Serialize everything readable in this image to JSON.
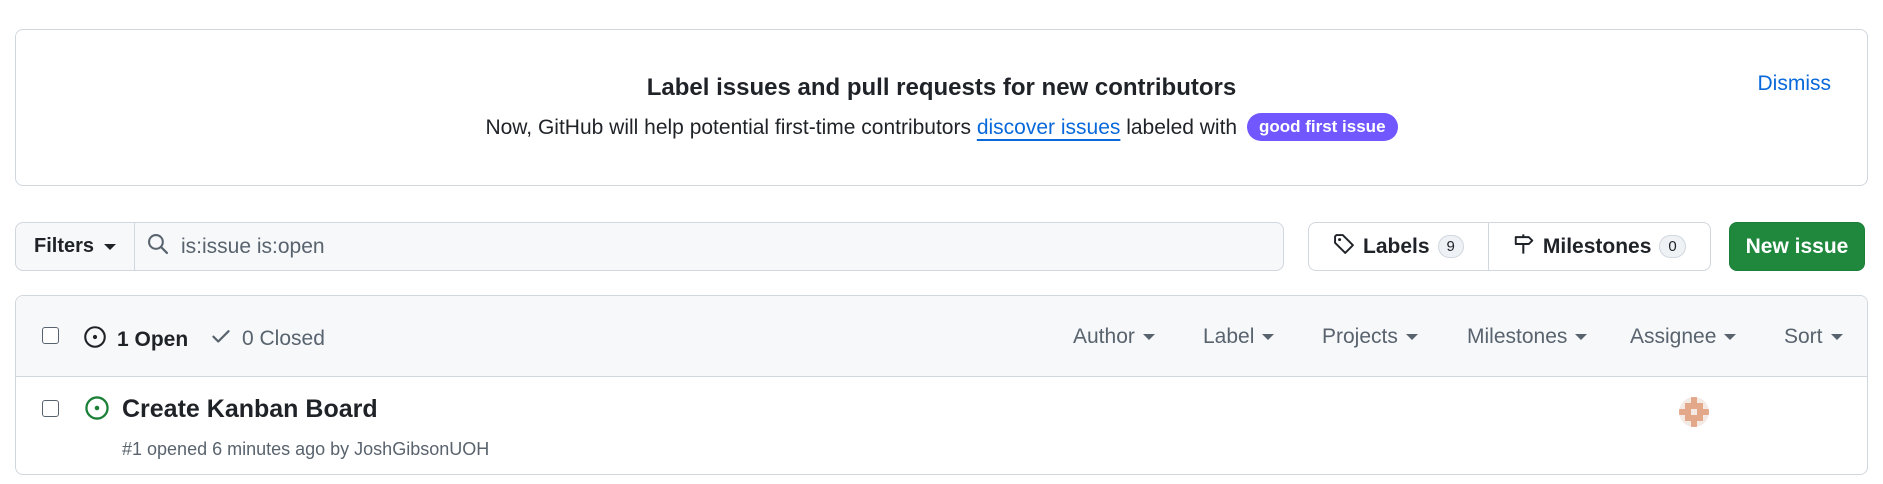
{
  "banner": {
    "title": "Label issues and pull requests for new contributors",
    "text_prefix": "Now, GitHub will help potential first-time contributors ",
    "link_text": "discover issues",
    "text_middle": " labeled with ",
    "badge": "good first issue",
    "dismiss": "Dismiss"
  },
  "toolbar": {
    "filters": "Filters",
    "search_value": "is:issue is:open",
    "labels": "Labels",
    "labels_count": "9",
    "milestones": "Milestones",
    "milestones_count": "0",
    "new_issue": "New issue"
  },
  "issues_header": {
    "open": "1 Open",
    "closed": "0 Closed",
    "menus": [
      "Author",
      "Label",
      "Projects",
      "Milestones",
      "Assignee",
      "Sort"
    ]
  },
  "issues": [
    {
      "title": "Create Kanban Board",
      "meta_prefix": "#1 opened 6 minutes ago by ",
      "author": "JoshGibsonUOH"
    }
  ],
  "colors": {
    "accent": "#0969da",
    "badge": "#7057ff",
    "primary_button": "#1f883d",
    "open_icon": "#1a7f37"
  }
}
